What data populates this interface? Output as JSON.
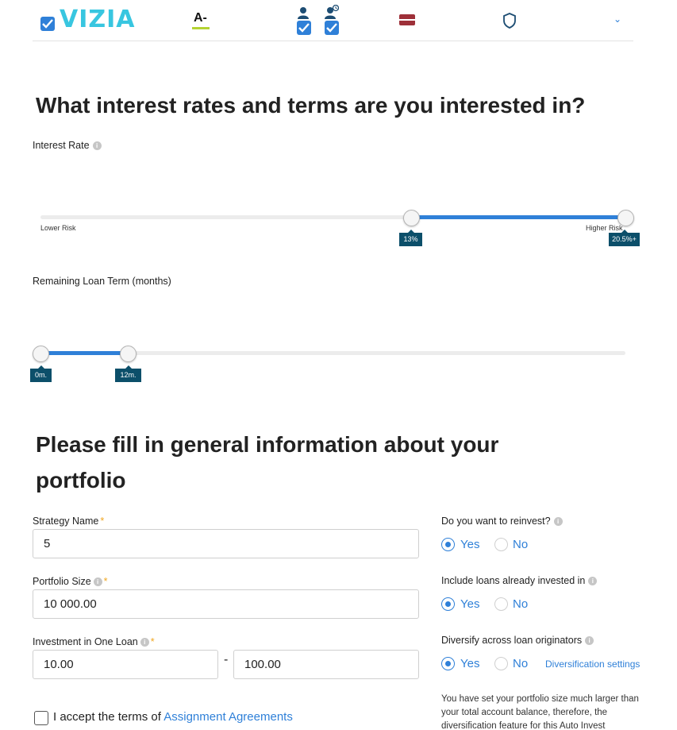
{
  "originator": {
    "name": "VIZIA",
    "grade": "A-",
    "accent": "#38c6e0",
    "grade_color": "#b4d333",
    "flag_colors": [
      "#9e3039",
      "#ffffff"
    ]
  },
  "interest": {
    "title": "What interest rates and terms are you interested in?",
    "label": "Interest Rate",
    "left_axis": "Lower Risk",
    "right_axis": "Higher Risk",
    "min_value": "13%",
    "max_value": "20.5%+"
  },
  "term": {
    "label": "Remaining Loan Term (months)",
    "min_value": "0m.",
    "max_value": "12m."
  },
  "general": {
    "title": "Please fill in general information about your portfolio",
    "strategy_label": "Strategy Name",
    "strategy_value": "5",
    "portfolio_label": "Portfolio Size",
    "portfolio_value": "10 000.00",
    "investment_label": "Investment in One Loan",
    "investment_min": "10.00",
    "investment_max": "100.00",
    "required_mark": "*",
    "dash": "-"
  },
  "options": {
    "reinvest_label": "Do you want to reinvest?",
    "include_label": "Include loans already invested in",
    "diversify_label": "Diversify across loan originators",
    "yes": "Yes",
    "no": "No",
    "diversification_link": "Diversification settings",
    "warning": "You have set your portfolio size much larger than your total account balance, therefore, the diversification feature for this Auto Invest"
  },
  "terms": {
    "prefix": "I accept the terms of",
    "link": "Assignment Agreements"
  },
  "colors": {
    "primary": "#2f80d8",
    "tooltip": "#0c4f6a"
  }
}
